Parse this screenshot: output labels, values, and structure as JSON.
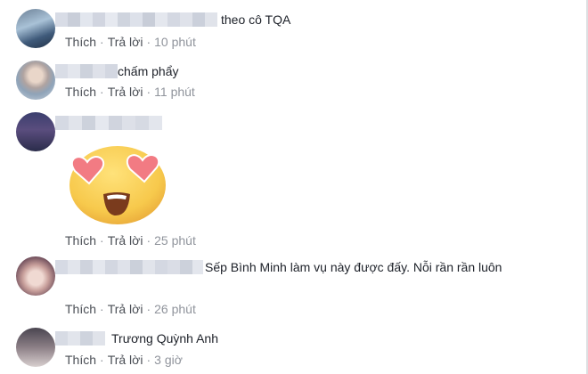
{
  "labels": {
    "like": "Thích",
    "reply": "Trả lời",
    "dot": "·"
  },
  "comments": [
    {
      "text": "theo cô TQA",
      "time": "10 phút"
    },
    {
      "text": "chấm phẩy",
      "time": "11 phút"
    },
    {
      "text": "",
      "sticker": "heart-eyes-face",
      "time": "25 phút"
    },
    {
      "text": "Sếp Bình Minh làm vụ này được đấy. Nỗi rần rần luôn",
      "time": "26 phút"
    },
    {
      "text": "Trương Quỳnh Anh",
      "time": "3 giờ"
    }
  ],
  "colors": {
    "action_link": "#4b4f56",
    "timestamp": "#90949c",
    "sticker_face": "#f7c94c",
    "sticker_heart": "#f27b83"
  }
}
